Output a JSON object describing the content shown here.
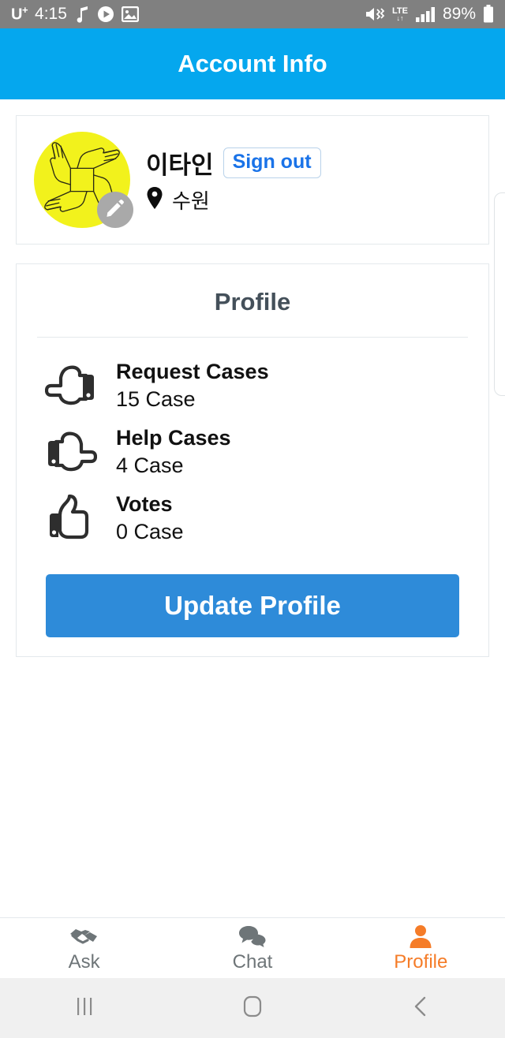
{
  "status_bar": {
    "carrier": "U",
    "carrier_sup": "+",
    "time": "4:15",
    "battery_percent": "89%",
    "lte_label": "LTE",
    "lte_arrows": "↓↑",
    "icons": [
      "music-note-icon",
      "play-circle-icon",
      "image-icon",
      "mute-icon",
      "lte-icon",
      "signal-bars-icon",
      "battery-icon"
    ]
  },
  "header": {
    "title": "Account Info"
  },
  "account": {
    "user_name": "이타인",
    "signout_label": "Sign out",
    "location": "수원",
    "avatar_alt": "hands-circle-avatar",
    "edit_badge": "pencil-icon"
  },
  "profile": {
    "title": "Profile",
    "stats": [
      {
        "icon": "hand-point-left-icon",
        "label": "Request Cases",
        "value": "15 Case"
      },
      {
        "icon": "hand-point-right-icon",
        "label": "Help Cases",
        "value": "4 Case"
      },
      {
        "icon": "thumbs-up-icon",
        "label": "Votes",
        "value": "0 Case"
      }
    ],
    "update_button": "Update Profile"
  },
  "tab_bar": {
    "tabs": [
      {
        "label": "Ask",
        "icon": "handshake-icon",
        "active": false
      },
      {
        "label": "Chat",
        "icon": "chat-bubbles-icon",
        "active": false
      },
      {
        "label": "Profile",
        "icon": "person-icon",
        "active": true
      }
    ]
  },
  "nav_bar": {
    "buttons": [
      {
        "name": "recents-button",
        "icon": "recents-icon"
      },
      {
        "name": "home-button",
        "icon": "home-icon"
      },
      {
        "name": "back-button",
        "icon": "back-chevron-icon"
      }
    ]
  },
  "colors": {
    "header_blue": "#05a7ee",
    "button_blue": "#2e8bd9",
    "link_blue": "#1a73e8",
    "accent_orange": "#f57c28",
    "avatar_yellow": "#f2f21c",
    "status_gray": "#808080"
  }
}
